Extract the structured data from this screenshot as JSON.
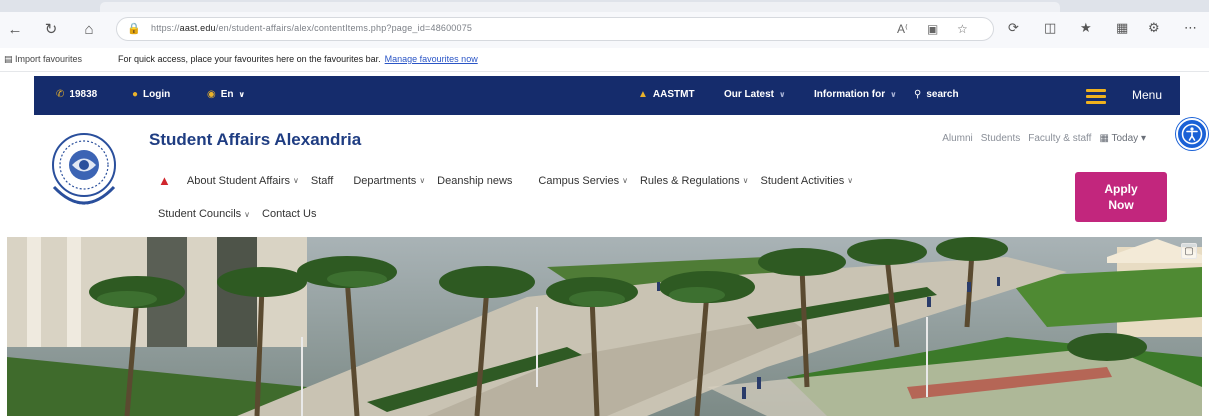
{
  "browser": {
    "url_prefix": "https://",
    "url_domain": "aast.edu",
    "url_path": "/en/student-affairs/alex/contentItems.php?page_id=48600075",
    "fav_import": "Import favourites",
    "fav_message": "For quick access, place your favourites here on the favourites bar.",
    "fav_link": "Manage favourites now",
    "icons": [
      "back-icon",
      "refresh-icon",
      "home-icon",
      "lock-icon",
      "read-aloud-icon",
      "tab-icon",
      "star-icon",
      "refresh-icon",
      "split-screen-icon",
      "favorites-icon",
      "collections-icon",
      "extensions-icon",
      "more-icon"
    ]
  },
  "topbar": {
    "phone": "19838",
    "login": "Login",
    "language": "En",
    "aastmt": "AASTMT",
    "our_latest": "Our Latest",
    "information_for": "Information for",
    "search": "search",
    "menu": "Menu"
  },
  "header": {
    "title": "Student Affairs  Alexandria",
    "quick_links": [
      "Alumni",
      "Students",
      "Faculty & staff"
    ],
    "today": "Today",
    "apply_line1": "Apply",
    "apply_line2": "Now"
  },
  "nav": {
    "row1": [
      {
        "label": "About Student Affairs",
        "dropdown": true
      },
      {
        "label": "Staff",
        "dropdown": false
      },
      {
        "label": "Departments",
        "dropdown": true
      },
      {
        "label": "Deanship news",
        "dropdown": false
      },
      {
        "label": "Campus Servies",
        "dropdown": true
      },
      {
        "label": "Rules & Regulations",
        "dropdown": true
      },
      {
        "label": "Student Activities",
        "dropdown": true
      }
    ],
    "row2": [
      {
        "label": "Student Councils",
        "dropdown": true
      },
      {
        "label": "Contact Us",
        "dropdown": false
      }
    ]
  },
  "colors": {
    "topbar_bg": "#152c6c",
    "title": "#1f3d82",
    "accent_gold": "#f0b21e",
    "apply_bg": "#c2267d",
    "home_red": "#d0262d",
    "access_blue": "#1a61d6"
  }
}
